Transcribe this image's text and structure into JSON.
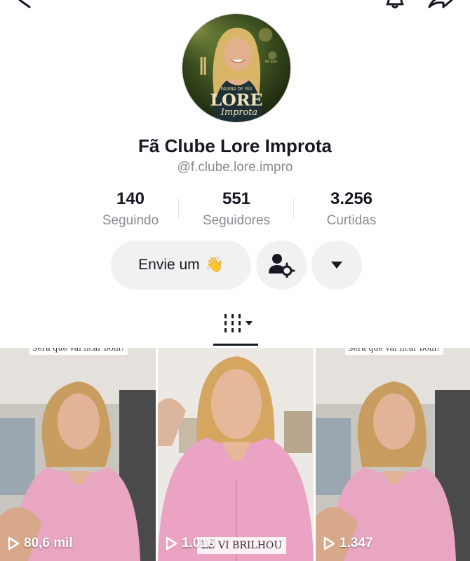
{
  "profile": {
    "name": "Fã Clube Lore Improta",
    "handle": "@f.clube.lore.impro",
    "avatar_text": {
      "small": "PÁGINA DE FÃS",
      "big": "LORE",
      "script": "Improta"
    }
  },
  "stats": [
    {
      "value": "140",
      "label": "Seguindo"
    },
    {
      "value": "551",
      "label": "Seguidores"
    },
    {
      "value": "3.256",
      "label": "Curtidas"
    }
  ],
  "actions": {
    "message_label": "Envie um",
    "message_emoji": "👋",
    "follow_settings_icon": "user-gear-icon",
    "dropdown_icon": "caret-down-icon"
  },
  "tabs": {
    "videos_icon": "grid-icon"
  },
  "videos": [
    {
      "views": "80,6 mil",
      "caption": "Será que vai ficar bom?"
    },
    {
      "views": "1.016",
      "caption": "LE VI BRILHOU"
    },
    {
      "views": "1.347",
      "caption": "Será que vai ficar bom?"
    }
  ],
  "colors": {
    "text_primary": "#161823",
    "text_secondary": "#8a8b91",
    "button_bg": "#f1f1f2",
    "shirt_pink": "#e7a4c4"
  }
}
